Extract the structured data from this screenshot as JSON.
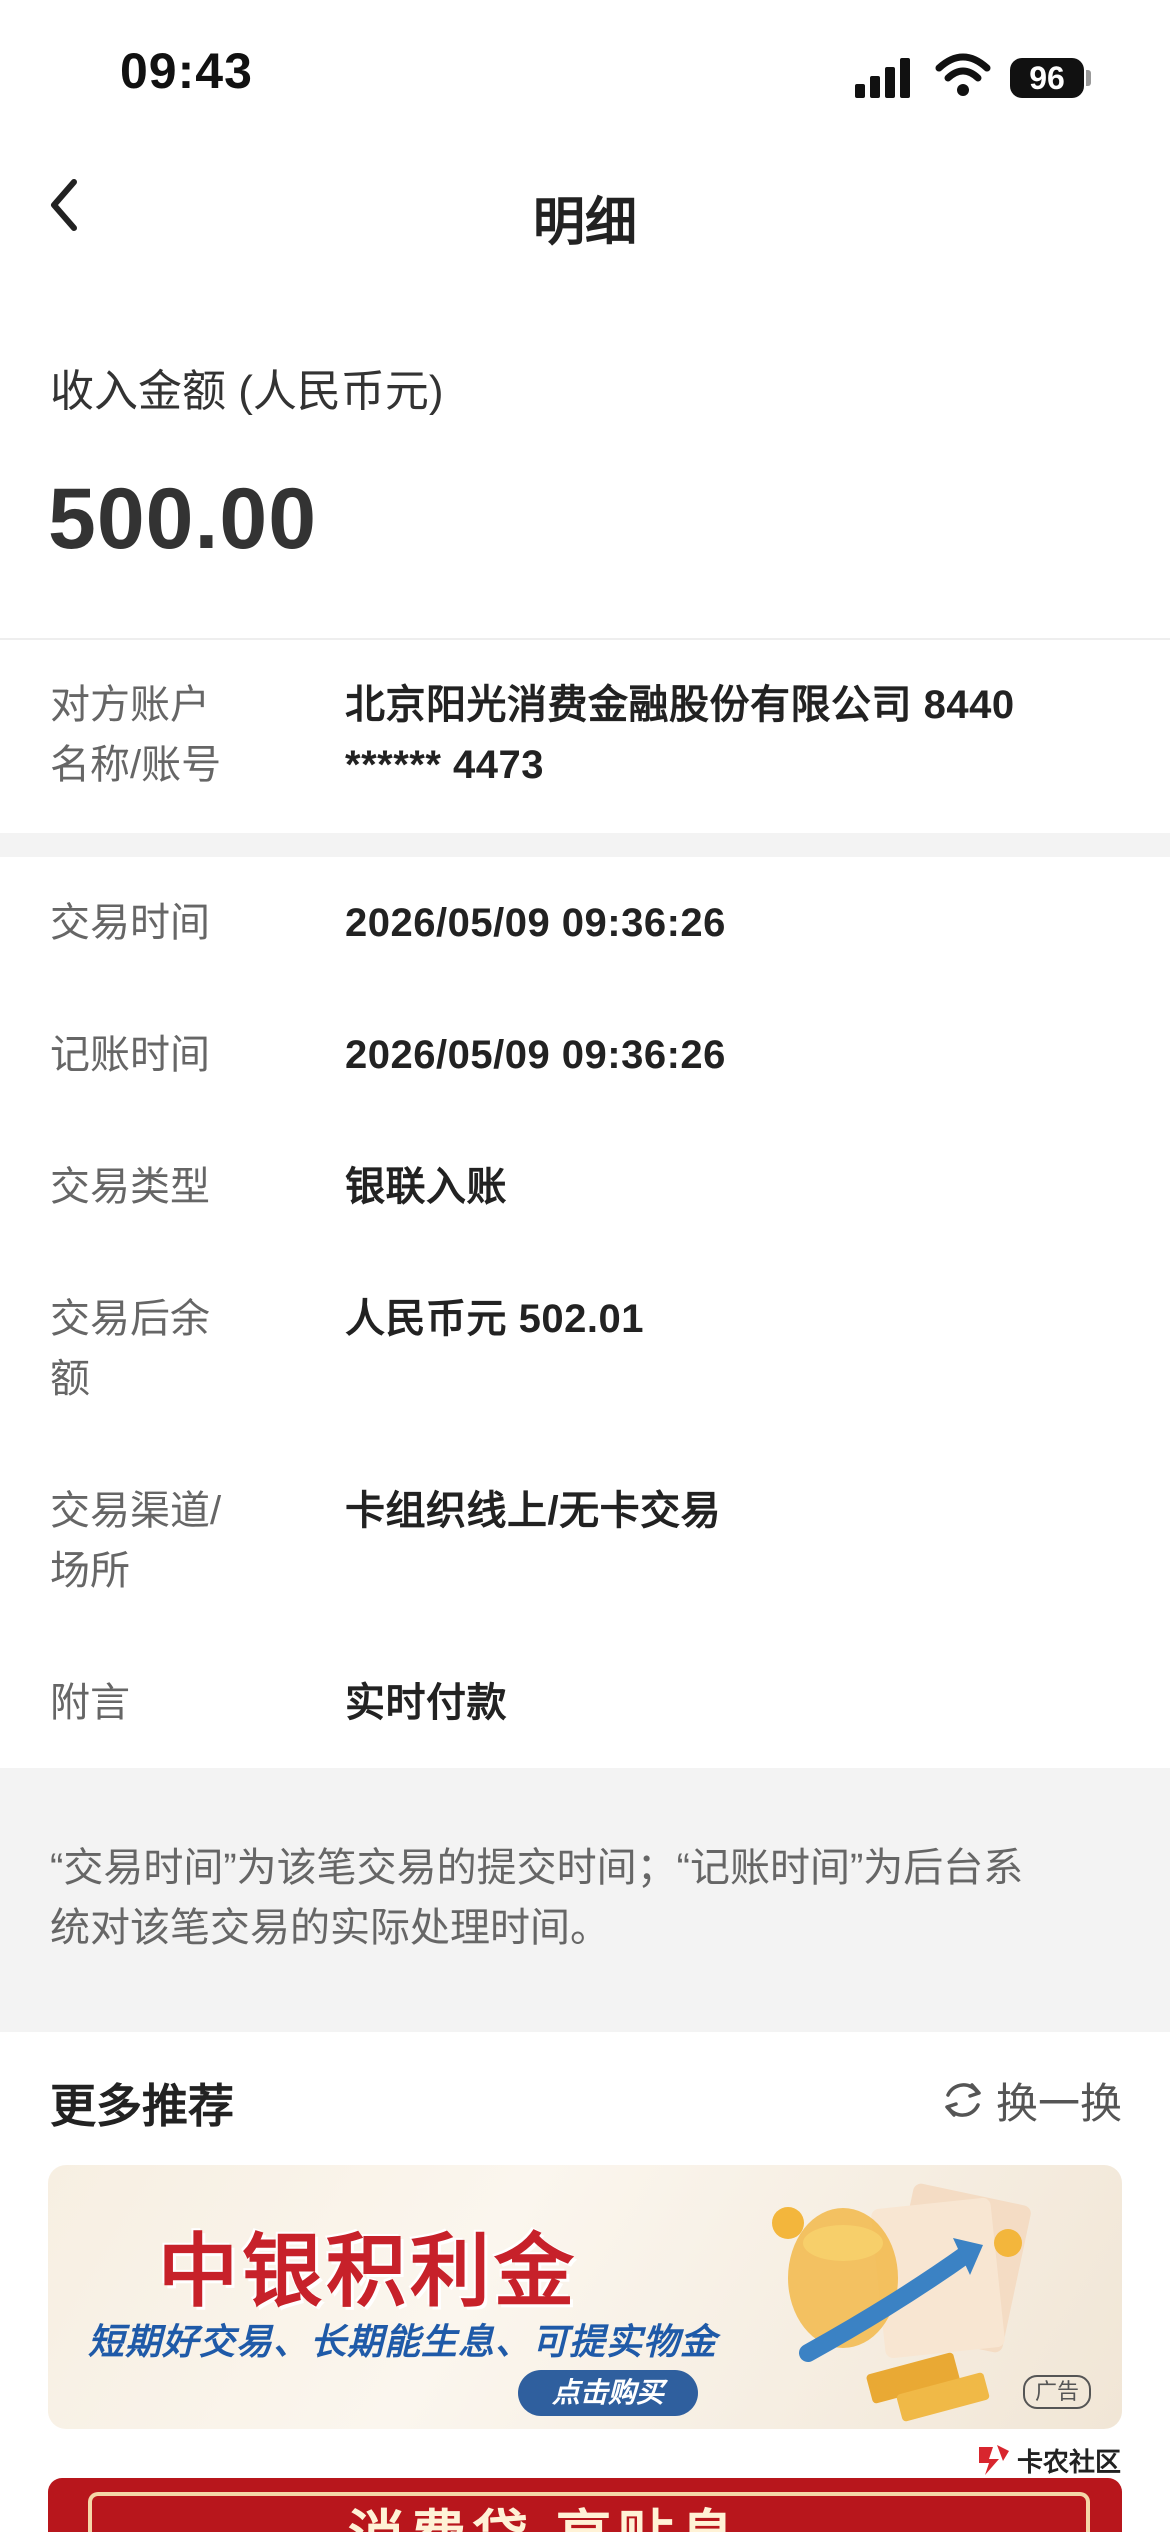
{
  "status_bar": {
    "time": "09:43",
    "battery": "96"
  },
  "nav": {
    "title": "明细"
  },
  "amount": {
    "label": "收入金额 (人民币元)",
    "value": "500.00"
  },
  "counterparty": {
    "label_line1": "对方账户",
    "label_line2": "名称/账号",
    "value_line1": "北京阳光消费金融股份有限公司 8440",
    "value_line2": "****** 4473"
  },
  "details": [
    {
      "label_line1": "交易时间",
      "label_line2": "",
      "value": "2026/05/09 09:36:26"
    },
    {
      "label_line1": "记账时间",
      "label_line2": "",
      "value": "2026/05/09 09:36:26"
    },
    {
      "label_line1": "交易类型",
      "label_line2": "",
      "value": "银联入账"
    },
    {
      "label_line1": "交易后余",
      "label_line2": "额",
      "value": "人民币元 502.01"
    },
    {
      "label_line1": "交易渠道/",
      "label_line2": "场所",
      "value": "卡组织线上/无卡交易"
    },
    {
      "label_line1": "附言",
      "label_line2": "",
      "value": "实时付款"
    }
  ],
  "note": {
    "line1": "“交易时间”为该笔交易的提交时间；“记账时间”为后台系",
    "line2": "统对该笔交易的实际处理时间。"
  },
  "more": {
    "title": "更多推荐",
    "refresh_label": "换一换"
  },
  "banner": {
    "headline": "中银积利金",
    "subtitle": "短期好交易、长期能生息、可提实物金",
    "cta": "点击购买",
    "ad_tag": "广告"
  },
  "banner2": {
    "text": "消费贷 享贴息"
  },
  "watermark": {
    "text": "卡农社区"
  },
  "colors": {
    "accent_red": "#c7212a",
    "banner_blue": "#2f5f9e"
  }
}
